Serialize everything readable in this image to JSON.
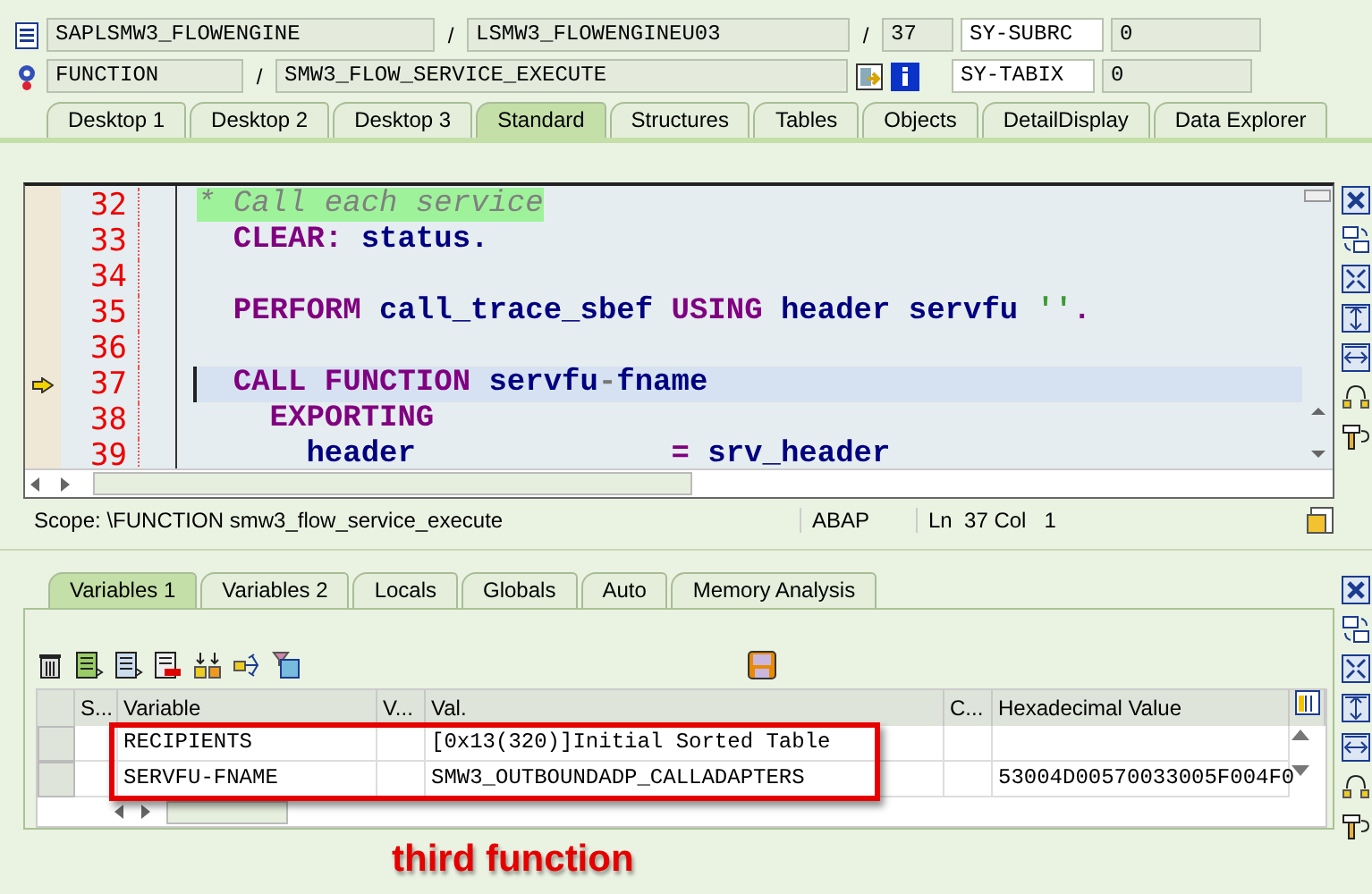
{
  "header_fields": [
    [
      {
        "kind": "program-icon"
      },
      {
        "kind": "field",
        "text": "SAPLSMW3_FLOWENGINE"
      },
      {
        "kind": "sep",
        "text": "/"
      },
      {
        "kind": "field",
        "text": "LSMW3_FLOWENGINEU03"
      },
      {
        "kind": "sep",
        "text": "/"
      },
      {
        "kind": "field",
        "text": "37"
      },
      {
        "kind": "sysvar",
        "text": "SY-SUBRC"
      },
      {
        "kind": "field",
        "text": "0"
      }
    ],
    [
      {
        "kind": "gear-icon"
      },
      {
        "kind": "field",
        "text": "FUNCTION"
      },
      {
        "kind": "sep",
        "text": "/"
      },
      {
        "kind": "field",
        "text": "SMW3_FLOW_SERVICE_EXECUTE"
      },
      {
        "kind": "module-icon"
      },
      {
        "kind": "info-icon"
      },
      {
        "kind": "sysvar",
        "text": "SY-TABIX"
      },
      {
        "kind": "field",
        "text": "0"
      }
    ]
  ],
  "tabs": [
    {
      "label": "Desktop 1",
      "selected": false
    },
    {
      "label": "Desktop 2",
      "selected": false
    },
    {
      "label": "Desktop 3",
      "selected": false
    },
    {
      "label": "Standard",
      "selected": true
    },
    {
      "label": "Structures",
      "selected": false
    },
    {
      "label": "Tables",
      "selected": false
    },
    {
      "label": "Objects",
      "selected": false
    },
    {
      "label": "DetailDisplay",
      "selected": false
    },
    {
      "label": "Data Explorer",
      "selected": false
    }
  ],
  "editor": {
    "lines": [
      {
        "number": "32",
        "current": false,
        "tokens": [
          {
            "kind": "comment",
            "text": "* Call each service"
          }
        ]
      },
      {
        "number": "33",
        "current": false,
        "tokens": [
          {
            "kind": "keyword",
            "text": "  CLEAR:"
          },
          {
            "kind": "ident",
            "text": " status."
          }
        ]
      },
      {
        "number": "34",
        "current": false
      },
      {
        "number": "35",
        "current": false,
        "tokens": [
          {
            "kind": "keyword",
            "text": "  PERFORM"
          },
          {
            "kind": "ident",
            "text": " call_trace_sbef "
          },
          {
            "kind": "keyword",
            "text": "USING"
          },
          {
            "kind": "ident",
            "text": " header servfu "
          },
          {
            "kind": "string",
            "text": "''"
          },
          {
            "kind": "punct",
            "text": "."
          }
        ]
      },
      {
        "number": "36",
        "current": false
      },
      {
        "number": "37",
        "current": true,
        "tokens": [
          {
            "kind": "keyword",
            "text": "  CALL FUNCTION"
          },
          {
            "kind": "ident",
            "text": " servfu"
          },
          {
            "kind": "minus",
            "text": "-"
          },
          {
            "kind": "ident",
            "text": "fname"
          }
        ]
      },
      {
        "number": "38",
        "current": false,
        "tokens": [
          {
            "kind": "keyword",
            "text": "    EXPORTING"
          }
        ]
      },
      {
        "number": "39",
        "current": false,
        "tokens": [
          {
            "kind": "ident",
            "text": "      header              "
          },
          {
            "kind": "punct",
            "text": "="
          },
          {
            "kind": "ident",
            "text": " srv_header"
          }
        ]
      }
    ]
  },
  "status_bar": {
    "scope": "Scope: \\FUNCTION smw3_flow_service_execute",
    "language": "ABAP",
    "position": "Ln  37 Col   1"
  },
  "lower_tabs": [
    {
      "label": "Variables 1",
      "selected": true
    },
    {
      "label": "Variables 2",
      "selected": false
    },
    {
      "label": "Locals",
      "selected": false
    },
    {
      "label": "Globals",
      "selected": false
    },
    {
      "label": "Auto",
      "selected": false
    },
    {
      "label": "Memory Analysis",
      "selected": false
    }
  ],
  "variables_table": {
    "columns": [
      "S...",
      "Variable",
      "V...",
      "Val.",
      "C...",
      "Hexadecimal Value"
    ],
    "rows": [
      {
        "variable": "RECIPIENTS",
        "value": "[0x13(320)]Initial Sorted Table",
        "highlighted": true
      },
      {
        "variable": "SERVFU-FNAME",
        "value": "SMW3_OUTBOUNDADP_CALLADAPTERS",
        "hexadecimal_value": "53004D00570033005F004F0",
        "highlighted": true
      }
    ]
  },
  "annotation": {
    "text": "third function"
  }
}
